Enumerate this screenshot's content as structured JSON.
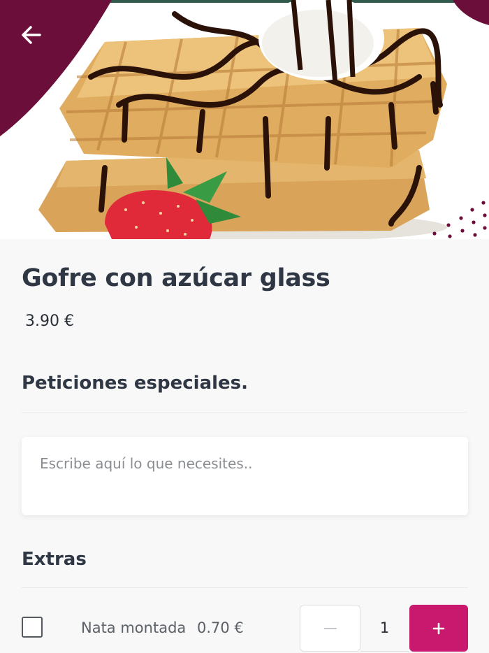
{
  "product": {
    "name": "Gofre con azúcar glass",
    "price": "3.90 €",
    "image_icon": "waffle-image"
  },
  "special_requests": {
    "heading": "Peticiones especiales.",
    "placeholder": "Escribe aquí lo que necesites.."
  },
  "extras": {
    "heading": "Extras",
    "items": [
      {
        "name": "Nata montada",
        "price": "0.70 €",
        "quantity": "1",
        "checked": false
      }
    ]
  },
  "colors": {
    "brand_dark": "#6b0f3a",
    "accent": "#c8196f"
  },
  "icons": {
    "back": "arrow-left-icon",
    "minus": "minus-icon",
    "plus": "plus-icon"
  }
}
